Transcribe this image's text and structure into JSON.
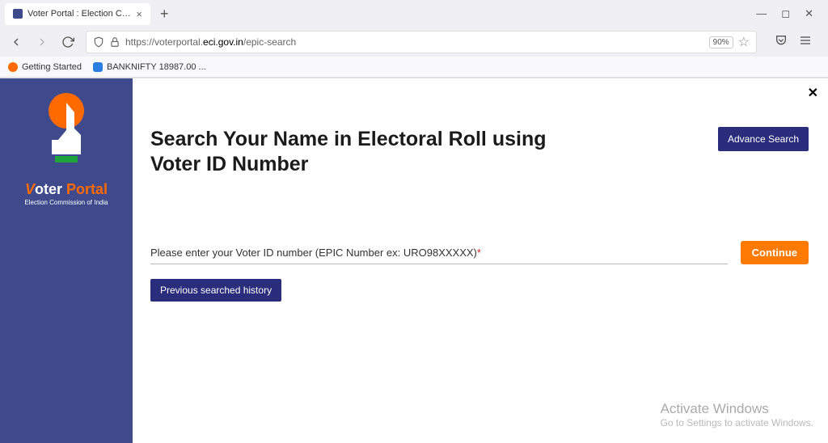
{
  "browser": {
    "tab_title": "Voter Portal : Election Commiss",
    "url_prefix": "https://voterportal.",
    "url_domain": "eci.gov.in",
    "url_path": "/epic-search",
    "zoom": "90%"
  },
  "bookmarks": {
    "item1": "Getting Started",
    "item2": "BANKNIFTY 18987.00 ..."
  },
  "sidebar": {
    "brand_prefix": "oter ",
    "brand_suffix": "Portal",
    "subtitle": "Election Commission of India"
  },
  "main": {
    "heading": "Search Your Name in Electoral Roll using Voter ID Number",
    "advance_btn": "Advance Search",
    "input_placeholder": "Please enter your Voter ID number (EPIC Number ex: URO98XXXXX)",
    "continue_btn": "Continue",
    "history_btn": "Previous searched history"
  },
  "watermark": {
    "title": "Activate Windows",
    "sub": "Go to Settings to activate Windows."
  }
}
